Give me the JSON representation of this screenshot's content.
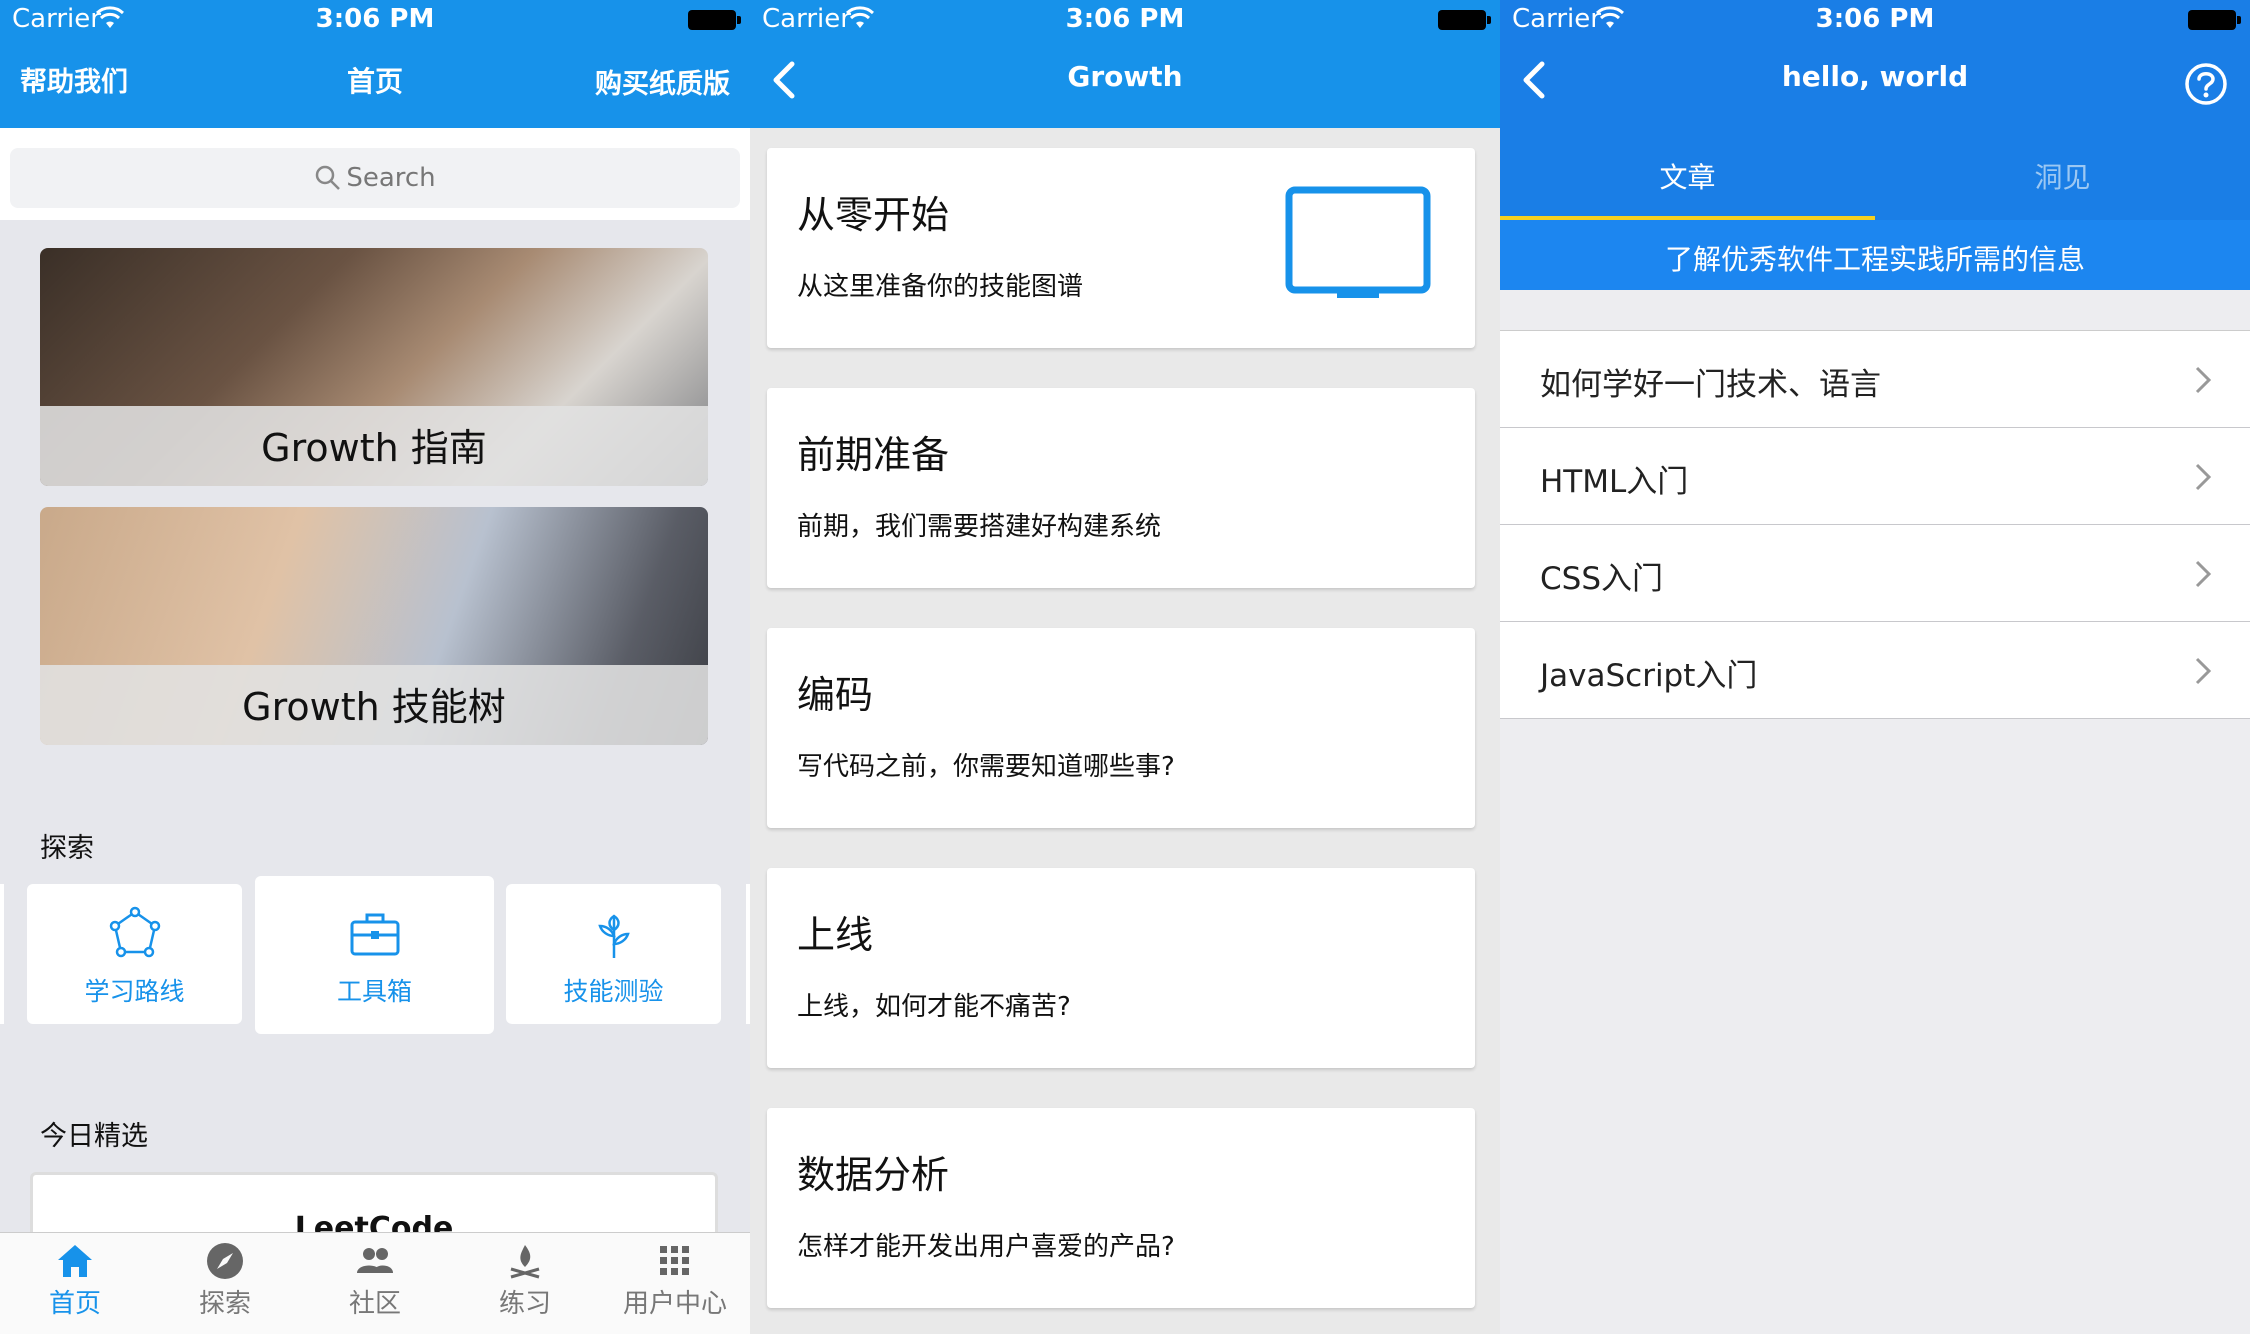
{
  "status": {
    "carrier": "Carrier",
    "time": "3:06 PM"
  },
  "home": {
    "nav": {
      "left": "帮助我们",
      "title": "首页",
      "right": "购买纸质版"
    },
    "search": {
      "placeholder": "Search"
    },
    "banners": [
      {
        "caption": "Growth 指南"
      },
      {
        "caption": "Growth 技能树"
      }
    ],
    "explore_title": "探索",
    "explore": [
      {
        "label": "学习路线",
        "icon": "route-icon"
      },
      {
        "label": "工具箱",
        "icon": "toolbox-icon"
      },
      {
        "label": "技能测验",
        "icon": "sprout-icon"
      }
    ],
    "featured_title": "今日精选",
    "featured": {
      "title": "LeetCode"
    },
    "tabs": [
      {
        "label": "首页",
        "icon": "home-icon",
        "active": true
      },
      {
        "label": "探索",
        "icon": "compass-icon"
      },
      {
        "label": "社区",
        "icon": "people-icon"
      },
      {
        "label": "练习",
        "icon": "campfire-icon"
      },
      {
        "label": "用户中心",
        "icon": "grid-icon"
      }
    ]
  },
  "growth": {
    "nav": {
      "title": "Growth"
    },
    "topics": [
      {
        "title": "从零开始",
        "subtitle": "从这里准备你的技能图谱"
      },
      {
        "title": "前期准备",
        "subtitle": "前期，我们需要搭建好构建系统"
      },
      {
        "title": "编码",
        "subtitle": "写代码之前，你需要知道哪些事?"
      },
      {
        "title": "上线",
        "subtitle": "上线，如何才能不痛苦?"
      },
      {
        "title": "数据分析",
        "subtitle": "怎样才能开发出用户喜爱的产品?"
      }
    ]
  },
  "hello": {
    "nav": {
      "title": "hello, world"
    },
    "segments": [
      {
        "label": "文章",
        "active": true
      },
      {
        "label": "洞见"
      }
    ],
    "info": "了解优秀软件工程实践所需的信息",
    "items": [
      "如何学好一门技术、语言",
      "HTML入门",
      "CSS入门",
      "JavaScript入门"
    ]
  },
  "colors": {
    "primary": "#1792ea",
    "nav_dark": "#1a7ee6",
    "highlight": "#f5d020"
  }
}
